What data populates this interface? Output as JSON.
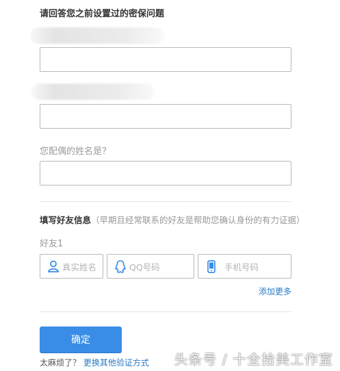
{
  "header": {
    "title": "请回答您之前设置过的密保问题"
  },
  "questions": [
    {
      "label": "",
      "value": ""
    },
    {
      "label": "",
      "value": ""
    },
    {
      "label": "您配偶的姓名是？",
      "value": ""
    }
  ],
  "friend_section": {
    "title": "填写好友信息",
    "note": "（早期且经常联系的好友是帮助您确认身份的有力证据）",
    "friend_label": "好友1",
    "name_placeholder": "真实姓名",
    "qq_placeholder": "QQ号码",
    "phone_placeholder": "手机号码",
    "add_more": "添加更多"
  },
  "actions": {
    "confirm": "确定",
    "too_much": "太麻烦了？",
    "other_method": "更换其他验证方式"
  },
  "watermark": "头条号 / 十全拾美工作室",
  "colors": {
    "primary": "#3a8de6",
    "link": "#2b7bc6"
  }
}
